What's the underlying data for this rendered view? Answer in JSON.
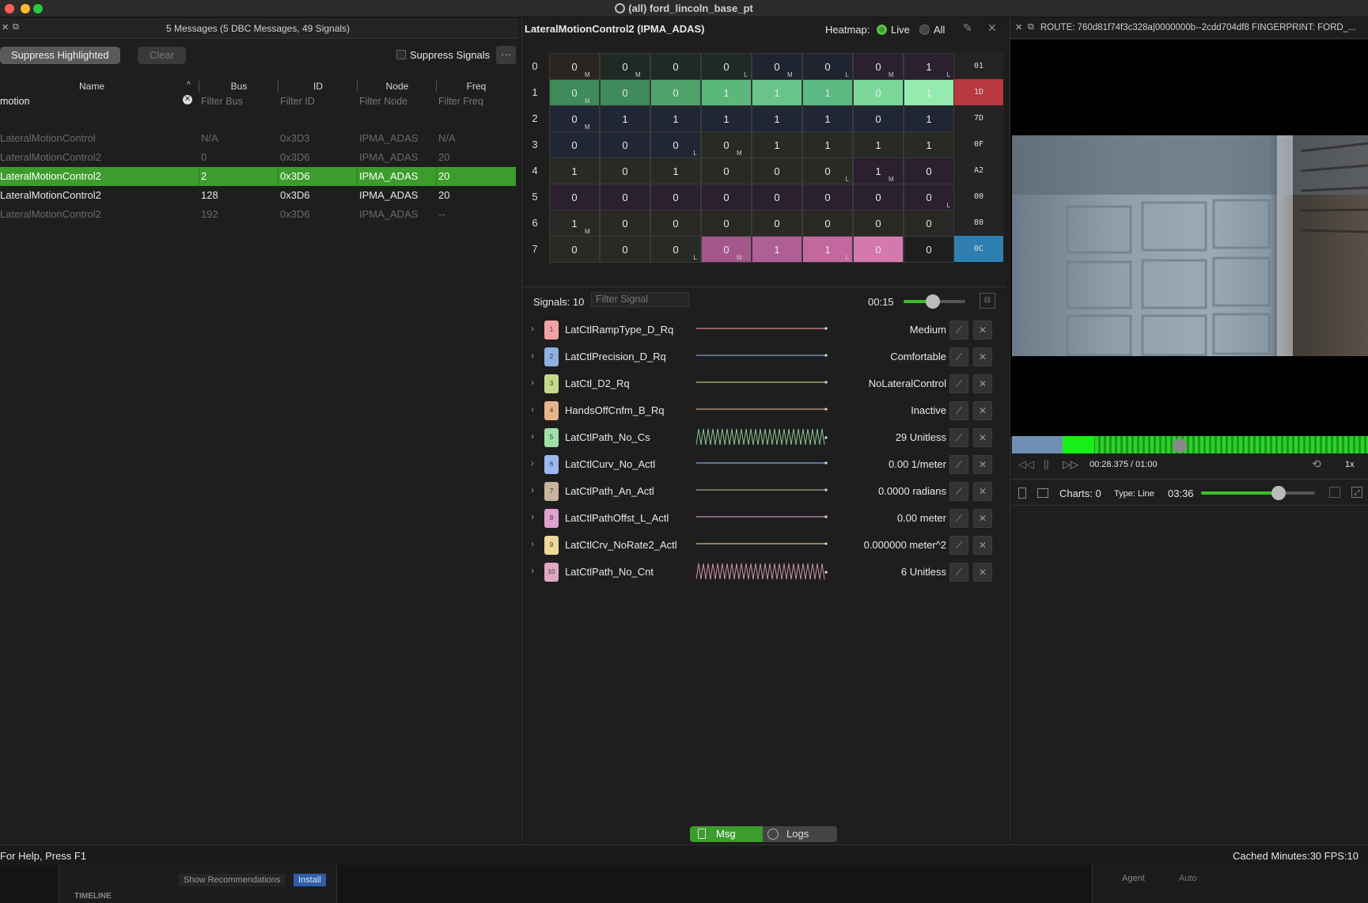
{
  "window": {
    "title": "(all) ford_lincoln_base_pt",
    "colors": {
      "close": "#fe5f57",
      "minimize": "#febc2e",
      "maximize": "#28c840",
      "accent": "#3c9c2c"
    }
  },
  "messages_panel": {
    "header": "5 Messages (5 DBC Messages, 49 Signals)",
    "suppress_highlighted_label": "Suppress Highlighted",
    "clear_label": "Clear",
    "suppress_signals_label": "Suppress Signals",
    "more_label": "···",
    "columns": [
      "Name",
      "Bus",
      "ID",
      "Node",
      "Freq"
    ],
    "filters": {
      "name_value": "motion",
      "bus_placeholder": "Filter Bus",
      "id_placeholder": "Filter ID",
      "node_placeholder": "Filter Node",
      "freq_placeholder": "Filter Freq"
    },
    "rows": [
      {
        "name": "LateralMotionControl",
        "bus": "N/A",
        "id": "0x3D3",
        "node": "IPMA_ADAS",
        "freq": "N/A",
        "state": "dim"
      },
      {
        "name": "LateralMotionControl2",
        "bus": "0",
        "id": "0x3D6",
        "node": "IPMA_ADAS",
        "freq": "20",
        "state": "dim"
      },
      {
        "name": "LateralMotionControl2",
        "bus": "2",
        "id": "0x3D6",
        "node": "IPMA_ADAS",
        "freq": "20",
        "state": "selected"
      },
      {
        "name": "LateralMotionControl2",
        "bus": "128",
        "id": "0x3D6",
        "node": "IPMA_ADAS",
        "freq": "20",
        "state": "normal"
      },
      {
        "name": "LateralMotionControl2",
        "bus": "192",
        "id": "0x3D6",
        "node": "IPMA_ADAS",
        "freq": "--",
        "state": "dim"
      }
    ]
  },
  "detail_panel": {
    "title": "LateralMotionControl2 (IPMA_ADAS)",
    "heatmap_label": "Heatmap:",
    "live_label": "Live",
    "all_label": "All",
    "hex_values": [
      "01",
      "1D",
      "7D",
      "0F",
      "A2",
      "00",
      "80",
      "0C"
    ],
    "rows": [
      [
        "0",
        "0",
        "0",
        "0",
        "0",
        "0",
        "0",
        "1"
      ],
      [
        "0",
        "0",
        "0",
        "1",
        "1",
        "1",
        "0",
        "1"
      ],
      [
        "0",
        "1",
        "1",
        "1",
        "1",
        "1",
        "0",
        "1"
      ],
      [
        "0",
        "0",
        "0",
        "0",
        "1",
        "1",
        "1",
        "1"
      ],
      [
        "1",
        "0",
        "1",
        "0",
        "0",
        "0",
        "1",
        "0"
      ],
      [
        "0",
        "0",
        "0",
        "0",
        "0",
        "0",
        "0",
        "0"
      ],
      [
        "1",
        "0",
        "0",
        "0",
        "0",
        "0",
        "0",
        "0"
      ],
      [
        "0",
        "0",
        "0",
        "0",
        "1",
        "1",
        "0",
        "0"
      ]
    ],
    "signals_label": "Signals: 10",
    "filter_signal_placeholder": "Filter Signal",
    "time_label": "00:15",
    "slider_level": 0.48,
    "signals": [
      {
        "index": "1",
        "name": "LatCtlRampType_D_Rq",
        "value": "Medium",
        "color": "#f2a2a2",
        "line": "#d98b8b",
        "wave": false
      },
      {
        "index": "2",
        "name": "LatCtlPrecision_D_Rq",
        "value": "Comfortable",
        "color": "#8fb0e0",
        "line": "#7b9ccc",
        "wave": false
      },
      {
        "index": "3",
        "name": "LatCtl_D2_Rq",
        "value": "NoLateralControl",
        "color": "#c8d88a",
        "line": "#b3c27a",
        "wave": false
      },
      {
        "index": "4",
        "name": "HandsOffCnfm_B_Rq",
        "value": "Inactive",
        "color": "#e8b48a",
        "line": "#c9a184",
        "wave": false
      },
      {
        "index": "5",
        "name": "LatCtlPath_No_Cs",
        "value": "29 Unitless",
        "color": "#9ee0a8",
        "line": "#89c496",
        "wave": true
      },
      {
        "index": "6",
        "name": "LatCtlCurv_No_Actl",
        "value": "0.00 1/meter",
        "color": "#9ab8ee",
        "line": "#86a6d8",
        "wave": false
      },
      {
        "index": "7",
        "name": "LatCtlPath_An_Actl",
        "value": "0.0000 radians",
        "color": "#c8b49a",
        "line": "#b3a184",
        "wave": false
      },
      {
        "index": "8",
        "name": "LatCtlPathOffst_L_Actl",
        "value": "0.00 meter",
        "color": "#e0a0d0",
        "line": "#c58cb8",
        "wave": false
      },
      {
        "index": "9",
        "name": "LatCtlCrv_NoRate2_Actl",
        "value": "0.000000 meter^2",
        "color": "#eed89a",
        "line": "#d4c38a",
        "wave": false
      },
      {
        "index": "10",
        "name": "LatCtlPath_No_Cnt",
        "value": "6 Unitless",
        "color": "#e0a8c0",
        "line": "#c890a8",
        "wave": true
      }
    ],
    "tabs": {
      "msg": "Msg",
      "logs": "Logs"
    }
  },
  "video_panel": {
    "route_label": "ROUTE: 760d81f74f3c328a|0000000b--2cdd704df8  FINGERPRINT: FORD_...",
    "time": "00:28.375 / 01:00",
    "speed": "1x",
    "charts_label": "Charts: 0",
    "type_label": "Type: Line",
    "chart_time": "03:36",
    "timeline_position": 0.47,
    "chart_slider_level": 0.68
  },
  "status": {
    "help": "For Help, Press F1",
    "cache": "Cached Minutes:30 FPS:10"
  },
  "bottom": {
    "show_recommendations": "Show Recommendations",
    "install": "Install",
    "timeline": "TIMELINE",
    "agent": "Agent",
    "auto": "Auto"
  }
}
